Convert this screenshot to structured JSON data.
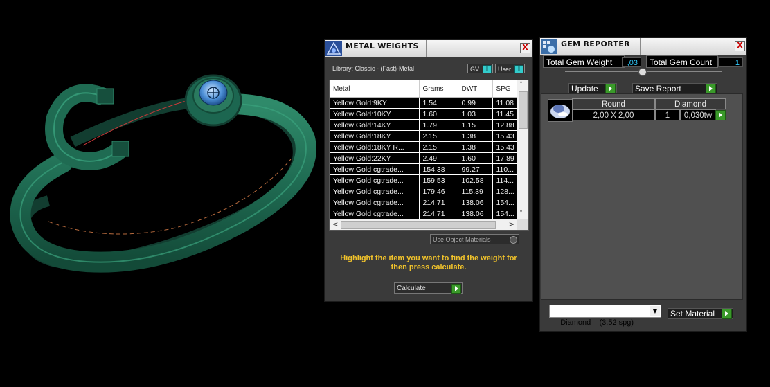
{
  "colors": {
    "metal_green": "#1f6b52",
    "hint_yellow": "#f0c22b",
    "value_cyan": "#33ccff",
    "play_green": "#3a9a2a"
  },
  "metal_weights": {
    "title": "METAL WEIGHTS",
    "close_label": "X",
    "library_label": "Library: Classic - (Fast)-Metal",
    "toggle_gv": "GV",
    "toggle_user": "User",
    "toggle_knob": "I",
    "columns": [
      "Metal",
      "Grams",
      "DWT",
      "SPG"
    ],
    "rows": [
      [
        "Yellow Gold:9KY",
        "1.54",
        "0.99",
        "11.08"
      ],
      [
        "Yellow Gold:10KY",
        "1.60",
        "1.03",
        "11.45"
      ],
      [
        "Yellow Gold:14KY",
        "1.79",
        "1.15",
        "12.88"
      ],
      [
        "Yellow Gold:18KY",
        "2.15",
        "1.38",
        "15.43"
      ],
      [
        "Yellow Gold:18KY R...",
        "2.15",
        "1.38",
        "15.43"
      ],
      [
        "Yellow Gold:22KY",
        "2.49",
        "1.60",
        "17.89"
      ],
      [
        "Yellow Gold cgtrade...",
        "154.38",
        "99.27",
        "110..."
      ],
      [
        "Yellow Gold cgtrade...",
        "159.53",
        "102.58",
        "114..."
      ],
      [
        "Yellow Gold cgtrade...",
        "179.46",
        "115.39",
        "128..."
      ],
      [
        "Yellow Gold cgtrade...",
        "214.71",
        "138.06",
        "154..."
      ],
      [
        "Yellow Gold cgtrade...",
        "214.71",
        "138.06",
        "154..."
      ]
    ],
    "use_object_materials": "Use Object Materials",
    "hint": "Highlight the item you want to find the weight for then press calculate.",
    "calculate_label": "Calculate"
  },
  "gem_reporter": {
    "title": "GEM REPORTER",
    "close_label": "X",
    "total_weight_label": "Total Gem Weight",
    "total_weight_value": ",03",
    "total_count_label": "Total Gem Count",
    "total_count_value": "1",
    "update_label": "Update",
    "save_report_label": "Save Report",
    "gems": [
      {
        "shape": "Round",
        "size": "2,00 X 2,00",
        "material": "Diamond",
        "count": "1",
        "weight": "0,030tw"
      }
    ],
    "material_select": "Diamond    (3,52 spg)",
    "set_material_label": "Set Material"
  }
}
